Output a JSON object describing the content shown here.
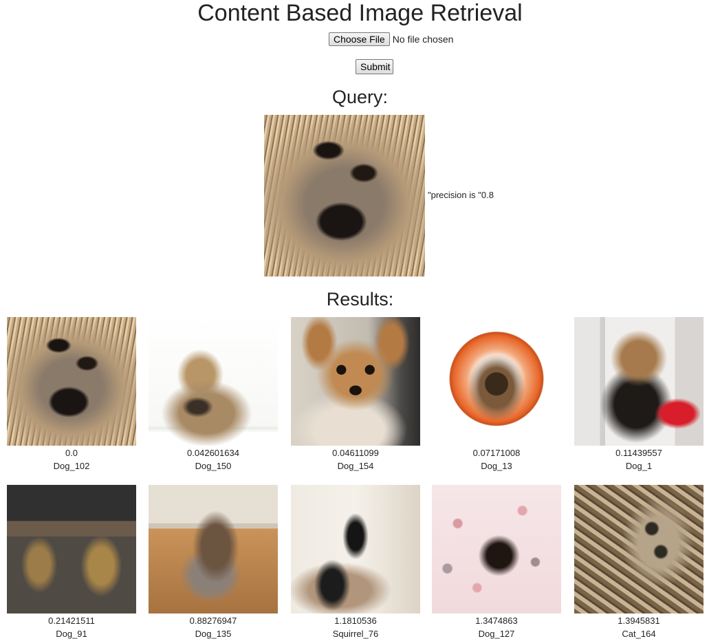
{
  "page": {
    "title": "Content Based Image Retrieval"
  },
  "upload": {
    "choose_label": "Choose File",
    "file_status": "No file chosen",
    "submit_label": "Submit"
  },
  "query": {
    "heading": "Query:",
    "image_name": "Dog_102",
    "precision_text": "\"precision is \"0.8"
  },
  "results": {
    "heading": "Results:",
    "items": [
      {
        "score": "0.0",
        "label": "Dog_102"
      },
      {
        "score": "0.042601634",
        "label": "Dog_150"
      },
      {
        "score": "0.04611099",
        "label": "Dog_154"
      },
      {
        "score": "0.07171008",
        "label": "Dog_13"
      },
      {
        "score": "0.11439557",
        "label": "Dog_1"
      },
      {
        "score": "0.21421511",
        "label": "Dog_91"
      },
      {
        "score": "0.88276947",
        "label": "Dog_135"
      },
      {
        "score": "1.1810536",
        "label": "Squirrel_76"
      },
      {
        "score": "1.3474863",
        "label": "Dog_127"
      },
      {
        "score": "1.3945831",
        "label": "Cat_164"
      }
    ]
  }
}
